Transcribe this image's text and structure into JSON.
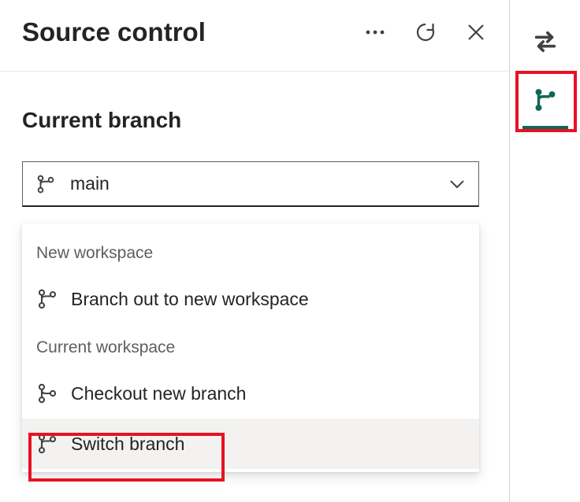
{
  "header": {
    "title": "Source control"
  },
  "branchSection": {
    "label": "Current branch",
    "selected": "main"
  },
  "dropdown": {
    "group1_label": "New workspace",
    "item_branch_out": "Branch out to new workspace",
    "group2_label": "Current workspace",
    "item_checkout": "Checkout new branch",
    "item_switch": "Switch branch"
  },
  "icons": {
    "more": "more-icon",
    "refresh": "refresh-icon",
    "close": "close-icon",
    "branch": "git-branch-icon",
    "chevron": "chevron-down-icon",
    "branch_merge": "git-merge-icon",
    "swap": "swap-icon"
  },
  "colors": {
    "highlight": "#e81123",
    "accent": "#0f6659"
  }
}
